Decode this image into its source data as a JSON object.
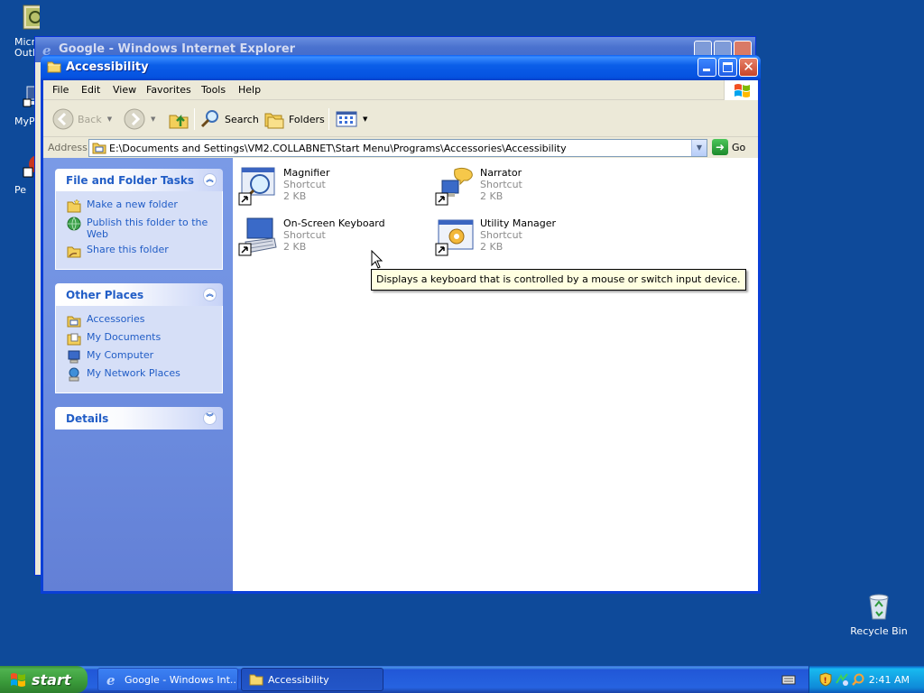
{
  "desktop": {
    "icons_left": [
      {
        "label": "Micro\nOutl"
      },
      {
        "label": "MyP"
      },
      {
        "label": "Pe"
      }
    ],
    "recycle_bin": {
      "label": "Recycle Bin"
    }
  },
  "background_window": {
    "title": "Google - Windows Internet Explorer"
  },
  "window": {
    "title": "Accessibility",
    "menu": [
      "File",
      "Edit",
      "View",
      "Favorites",
      "Tools",
      "Help"
    ],
    "toolbar": {
      "back": "Back",
      "search": "Search",
      "folders": "Folders"
    },
    "address": {
      "label": "Address",
      "path": "E:\\Documents and Settings\\VM2.COLLABNET\\Start Menu\\Programs\\Accessories\\Accessibility",
      "go": "Go"
    },
    "panels": {
      "file_tasks": {
        "title": "File and Folder Tasks",
        "items": [
          "Make a new folder",
          "Publish this folder to the Web",
          "Share this folder"
        ]
      },
      "other_places": {
        "title": "Other Places",
        "items": [
          "Accessories",
          "My Documents",
          "My Computer",
          "My Network Places"
        ]
      },
      "details": {
        "title": "Details"
      }
    },
    "files": [
      {
        "name": "Magnifier",
        "kind": "Shortcut",
        "size": "2 KB"
      },
      {
        "name": "Narrator",
        "kind": "Shortcut",
        "size": "2 KB"
      },
      {
        "name": "On-Screen Keyboard",
        "kind": "Shortcut",
        "size": "2 KB"
      },
      {
        "name": "Utility Manager",
        "kind": "Shortcut",
        "size": "2 KB"
      }
    ],
    "tooltip": "Displays a keyboard that is controlled by a mouse or switch input device."
  },
  "taskbar": {
    "start": "start",
    "buttons": [
      "Google - Windows Int...",
      "Accessibility"
    ],
    "clock": "2:41 AM"
  },
  "colors": {
    "desktop": "#0e4a9a",
    "titlebar": "#0552e0",
    "task_link": "#215dc6",
    "tooltip_bg": "#ffffe1"
  }
}
